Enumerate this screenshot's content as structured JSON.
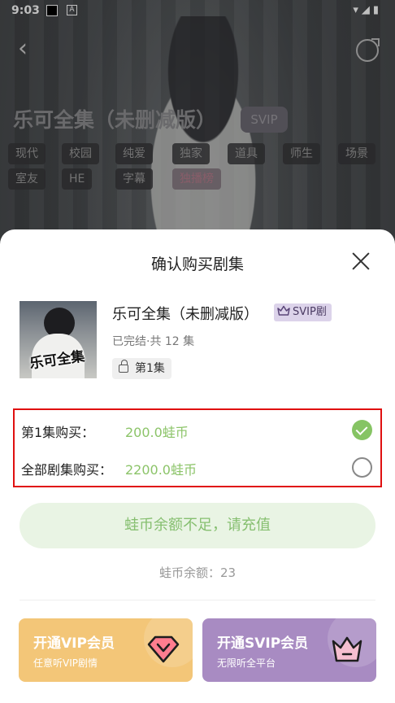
{
  "status_bar": {
    "time": "9:03",
    "app_icon": "A"
  },
  "background": {
    "title": "乐可全集（未删减版）",
    "badge": "SVIP",
    "tags": [
      "现代",
      "校园",
      "纯爱",
      "独家",
      "道具",
      "师生",
      "场景",
      "室友",
      "HE",
      "字幕",
      "独播榜"
    ]
  },
  "sheet": {
    "title": "确认购买剧集",
    "item": {
      "cover_text": "乐可全集",
      "title": "乐可全集（未删减版）",
      "badge": "SVIP剧",
      "meta": "已完结·共 12 集",
      "episode_chip": "第1集"
    },
    "options": [
      {
        "label": "第1集购买：",
        "price": "200.0蛙币",
        "selected": true
      },
      {
        "label": "全部剧集购买：",
        "price": "2200.0蛙币",
        "selected": false
      }
    ],
    "recharge_button": "蛙币余额不足，请充值",
    "balance": "蛙币余额：23",
    "promos": [
      {
        "title": "开通VIP会员",
        "subtitle": "任意听VIP剧情"
      },
      {
        "title": "开通SVIP会员",
        "subtitle": "无限听全平台"
      }
    ]
  },
  "colors": {
    "accent_green": "#86c464",
    "vip_gold": "#f3c678",
    "svip_purple": "#a88bc2",
    "highlight_red": "#e01010"
  }
}
